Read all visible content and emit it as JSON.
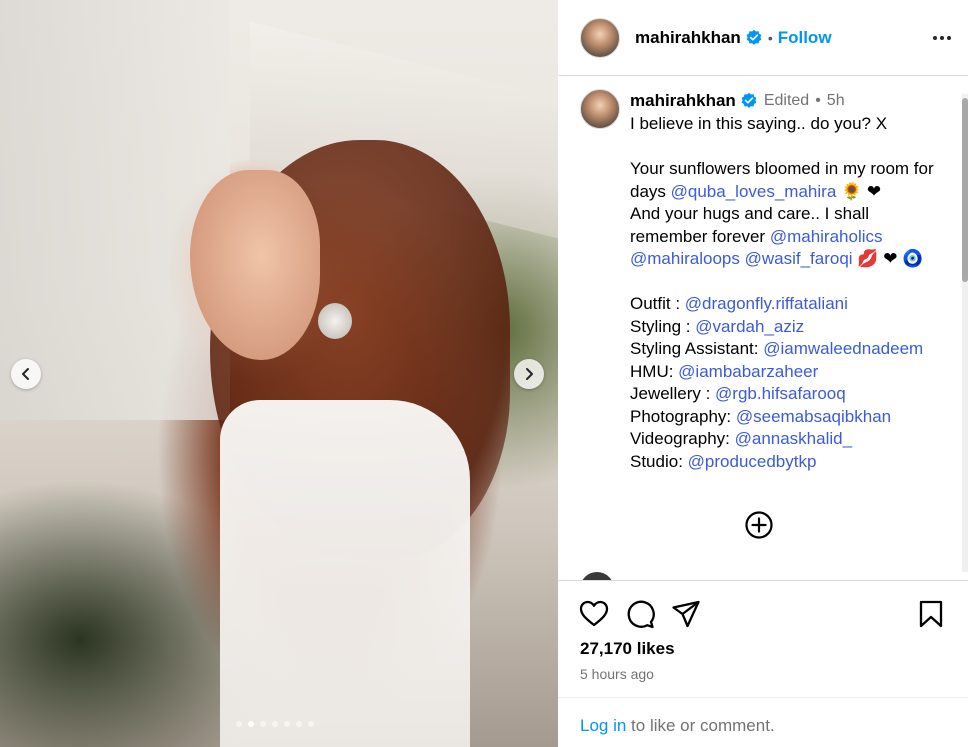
{
  "post": {
    "slide_count": 7,
    "active_slide": 2
  },
  "header": {
    "username": "mahirahkhan",
    "separator": "•",
    "follow_label": "Follow"
  },
  "caption": {
    "username": "mahirahkhan",
    "edited": "Edited",
    "separator": "•",
    "age": "5h",
    "line1": "I believe in this saying.. do you? X",
    "para1_a": "Your sunflowers bloomed in my room for days ",
    "para1_mention": "@quba_loves_mahira",
    "para1_emoji": " 🌻 ❤",
    "para2_a": "And your hugs and care.. I shall remember forever ",
    "para2_m1": "@mahiraholics",
    "para2_m2": "@mahiraloops",
    "para2_m3": "@wasif_faroqi",
    "para2_emoji": " 💋 ❤ 🧿",
    "credits": [
      {
        "label": "Outfit : ",
        "mention": "@dragonfly.riffataliani"
      },
      {
        "label": "Styling : ",
        "mention": "@vardah_aziz"
      },
      {
        "label": "Styling Assistant: ",
        "mention": "@iamwaleednadeem"
      },
      {
        "label": "HMU: ",
        "mention": "@iambabarzaheer"
      },
      {
        "label": "Jewellery : ",
        "mention": "@rgb.hifsafarooq"
      },
      {
        "label": "Photography: ",
        "mention": "@seemabsaqibkhan"
      },
      {
        "label": "Videography: ",
        "mention": "@annaskhalid_"
      },
      {
        "label": "Studio: ",
        "mention": "@producedbytkp"
      }
    ]
  },
  "stats": {
    "likes": "27,170 likes",
    "time": "5 hours ago"
  },
  "login": {
    "link": "Log in",
    "rest": " to like or comment."
  },
  "icons": {
    "like": "heart-icon",
    "comment": "comment-icon",
    "share": "share-icon",
    "save": "bookmark-icon",
    "more": "more-icon",
    "add": "add-comment-icon",
    "verified": "verified-badge-icon"
  },
  "colors": {
    "link_blue": "#0095f6",
    "mention_blue": "#3b5bdb",
    "muted": "#737373"
  }
}
